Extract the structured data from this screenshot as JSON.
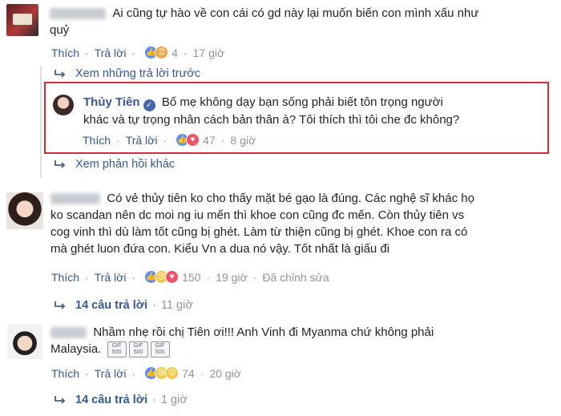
{
  "comments": [
    {
      "text": "Ai cũng tự hào về con cái có gd này lại muốn biến con mình xấu như",
      "text2": "quỷ",
      "actions": {
        "like": "Thích",
        "reply": "Trả lời",
        "count": "4",
        "time": "17 giờ"
      }
    },
    {
      "text": "Có vẻ thủy tiên ko cho thấy mặt bé gạo là đúng. Các nghệ sĩ khác họ",
      "text2": "ko scandan nên dc moi ng iu mến thì khoe con cũng đc mến. Còn thủy tiên vs",
      "text3": "cog vinh thì dù làm tốt cũng bị ghét. Làm từ thiện cũng bị ghét. Khoe con ra có",
      "text4": "mà ghét luon đứa con. Kiểu Vn a dua nó vậy. Tốt nhất là giấu đi",
      "actions": {
        "like": "Thích",
        "reply": "Trả lời",
        "count": "150",
        "time": "19 giờ",
        "edited": "Đã chỉnh sửa"
      },
      "replies_link": "14 câu trả lời",
      "replies_time": "11 giờ"
    },
    {
      "text": "Nhầm nhẹ rồi chị Tiên ơi!!! Anh Vinh đi Myanma chứ không phải",
      "text2": "Malaysia.",
      "gif_label": "GIF 500",
      "actions": {
        "like": "Thích",
        "reply": "Trả lời",
        "count": "74",
        "time": "20 giờ"
      },
      "replies_link": "14 câu trả lời",
      "replies_time": "1 giờ"
    }
  ],
  "prev_replies_link": "Xem những trả lời trước",
  "more_replies_link": "Xem phản hồi khác",
  "reply": {
    "name": "Thủy Tiên",
    "text": "Bố mẹ không dạy bạn sống phải biết tôn trọng người",
    "text2": "khác và tự trọng nhân cách bản thân à? Tôi thích thì tôi che đc không?",
    "actions": {
      "like": "Thích",
      "reply": "Trả lời",
      "count": "47",
      "time": "8 giờ"
    }
  },
  "colors": {
    "link": "#365899",
    "meta": "#90949c",
    "highlight_box": "#d42f2f"
  }
}
